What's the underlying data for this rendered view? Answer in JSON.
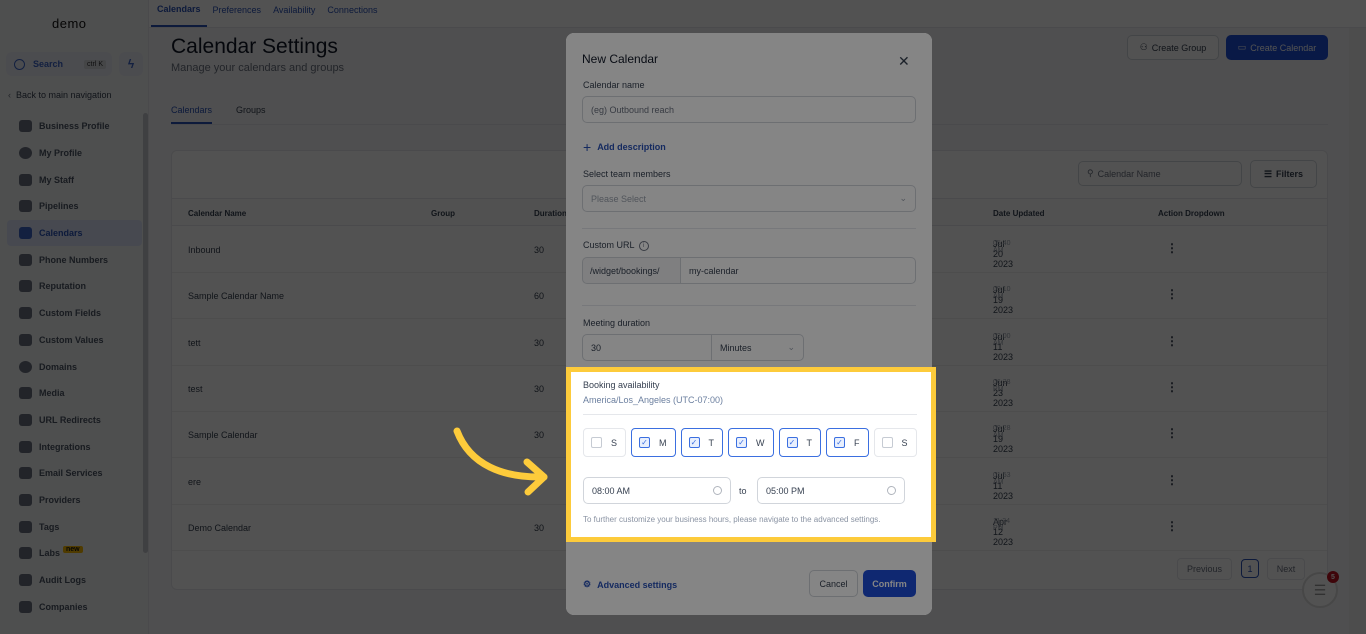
{
  "sidebar": {
    "logo": "demo",
    "search_label": "Search",
    "search_shortcut": "ctrl K",
    "back_label": "Back to main navigation",
    "items": [
      {
        "label": "Business Profile",
        "icon": "briefcase-icon"
      },
      {
        "label": "My Profile",
        "icon": "user-circle-icon"
      },
      {
        "label": "My Staff",
        "icon": "user-icon"
      },
      {
        "label": "Pipelines",
        "icon": "filter-icon"
      },
      {
        "label": "Calendars",
        "icon": "calendar-icon",
        "active": true
      },
      {
        "label": "Phone Numbers",
        "icon": "phone-icon"
      },
      {
        "label": "Reputation",
        "icon": "star-icon"
      },
      {
        "label": "Custom Fields",
        "icon": "fields-icon"
      },
      {
        "label": "Custom Values",
        "icon": "diamond-icon"
      },
      {
        "label": "Domains",
        "icon": "globe-icon"
      },
      {
        "label": "Media",
        "icon": "media-icon"
      },
      {
        "label": "URL Redirects",
        "icon": "redirect-icon"
      },
      {
        "label": "Integrations",
        "icon": "integrations-icon"
      },
      {
        "label": "Email Services",
        "icon": "mail-icon"
      },
      {
        "label": "Providers",
        "icon": "clipboard-icon"
      },
      {
        "label": "Tags",
        "icon": "tag-icon"
      },
      {
        "label": "Labs",
        "icon": "flask-icon",
        "badge": "new"
      },
      {
        "label": "Audit Logs",
        "icon": "bar-chart-icon"
      },
      {
        "label": "Companies",
        "icon": "building-icon"
      }
    ]
  },
  "topbar": {
    "tabs": [
      "Calendars",
      "Preferences",
      "Availability",
      "Connections"
    ],
    "active": "Calendars"
  },
  "page": {
    "title": "Calendar Settings",
    "subtitle": "Manage your calendars and groups",
    "create_group": "Create Group",
    "create_calendar": "Create Calendar",
    "subtabs": [
      "Calendars",
      "Groups"
    ],
    "search_placeholder": "Calendar Name",
    "filters_label": "Filters"
  },
  "table": {
    "columns": [
      "Calendar Name",
      "Group",
      "Duration",
      "Date Updated",
      "Action Dropdown"
    ],
    "rows": [
      {
        "name": "Inbound",
        "group": "",
        "duration": "30",
        "date": "Jul 20 2023",
        "time": "05:40 AM"
      },
      {
        "name": "Sample Calendar Name",
        "group": "",
        "duration": "60",
        "date": "Jul 19 2023",
        "time": "09:10 AM"
      },
      {
        "name": "tett",
        "group": "",
        "duration": "30",
        "date": "Jul 11 2023",
        "time": "02:00 AM"
      },
      {
        "name": "test",
        "group": "",
        "duration": "30",
        "date": "Jun 23 2023",
        "time": "06:28 PM"
      },
      {
        "name": "Sample Calendar",
        "group": "",
        "duration": "30",
        "date": "Jul 19 2023",
        "time": "09:28 AM"
      },
      {
        "name": "ere",
        "group": "",
        "duration": "",
        "date": "Jul 11 2023",
        "time": "01:53 AM"
      },
      {
        "name": "Demo Calendar",
        "group": "",
        "duration": "30",
        "date": "Apr 12 2023",
        "time": "11:34 PM"
      }
    ],
    "pagination": {
      "previous": "Previous",
      "current": "1",
      "next": "Next"
    }
  },
  "chat": {
    "badge": "5"
  },
  "modal": {
    "title": "New Calendar",
    "calendar_name_label": "Calendar name",
    "calendar_name_placeholder": "(eg) Outbound reach",
    "add_description": "Add description",
    "team_label": "Select team members",
    "team_placeholder": "Please Select",
    "custom_url_label": "Custom URL",
    "url_prefix": "/widget/bookings/",
    "url_value": "my-calendar",
    "duration_label": "Meeting duration",
    "duration_value": "30",
    "duration_unit": "Minutes",
    "booking": {
      "title": "Booking availability",
      "timezone": "America/Los_Angeles (UTC-07:00)",
      "days": [
        {
          "label": "S",
          "checked": false
        },
        {
          "label": "M",
          "checked": true
        },
        {
          "label": "T",
          "checked": true
        },
        {
          "label": "W",
          "checked": true
        },
        {
          "label": "T",
          "checked": true
        },
        {
          "label": "F",
          "checked": true
        },
        {
          "label": "S",
          "checked": false
        }
      ],
      "start_time": "08:00 AM",
      "to_label": "to",
      "end_time": "05:00 PM",
      "note": "To further customize your business hours, please navigate to the advanced settings."
    },
    "advanced_settings": "Advanced settings",
    "cancel": "Cancel",
    "confirm": "Confirm"
  },
  "colors": {
    "accent": "#1d4ed8",
    "highlight": "#fdcb3b",
    "badge": "#c1121f"
  }
}
